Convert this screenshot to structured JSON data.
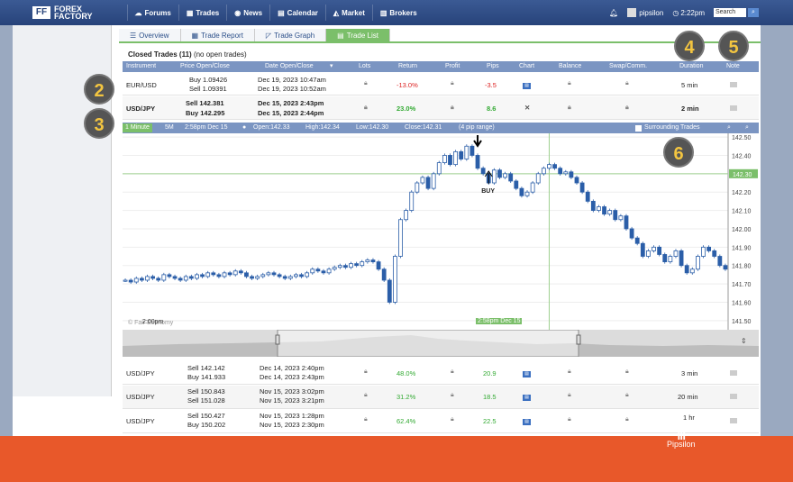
{
  "header": {
    "logo_line1": "FOREX",
    "logo_line2": "FACTORY",
    "nav": [
      {
        "label": "Forums",
        "icon": "forums-icon"
      },
      {
        "label": "Trades",
        "icon": "trades-icon"
      },
      {
        "label": "News",
        "icon": "news-icon"
      },
      {
        "label": "Calendar",
        "icon": "calendar-icon"
      },
      {
        "label": "Market",
        "icon": "market-icon"
      },
      {
        "label": "Brokers",
        "icon": "brokers-icon"
      }
    ],
    "username": "pipsilon",
    "time": "2:22pm",
    "search_placeholder": "Search"
  },
  "tabs": [
    {
      "label": "Overview",
      "active": false
    },
    {
      "label": "Trade Report",
      "active": false
    },
    {
      "label": "Trade Graph",
      "active": false
    },
    {
      "label": "Trade List",
      "active": true
    }
  ],
  "closed_trades": {
    "title": "Closed Trades (11)",
    "subtitle": "(no open trades)"
  },
  "columns": [
    "Instrument",
    "Price Open/Close",
    "Date Open/Close",
    "Lots",
    "Return",
    "Profit",
    "Pips",
    "Chart",
    "Balance",
    "Swap/Comm.",
    "Duration",
    "Note"
  ],
  "rows_top": [
    {
      "instrument": "EUR/USD",
      "price1": "Buy 1.09426",
      "price2": "Sell 1.09391",
      "date1": "Dec 19, 2023 10:47am",
      "date2": "Dec 19, 2023 10:52am",
      "return": "-13.0%",
      "pips": "-3.5",
      "duration": "5 min",
      "bold": false,
      "return_color": "red"
    },
    {
      "instrument": "USD/JPY",
      "price1": "Sell 142.381",
      "price2": "Buy 142.295",
      "date1": "Dec 15, 2023 2:43pm",
      "date2": "Dec 15, 2023 2:44pm",
      "return": "23.0%",
      "pips": "8.6",
      "duration": "2 min",
      "bold": true,
      "return_color": "green"
    }
  ],
  "rows_bottom": [
    {
      "instrument": "USD/JPY",
      "price1": "Sell 142.142",
      "price2": "Buy 141.933",
      "date1": "Dec 14, 2023 2:40pm",
      "date2": "Dec 14, 2023 2:43pm",
      "return": "48.0%",
      "pips": "20.9",
      "duration": "3 min"
    },
    {
      "instrument": "USD/JPY",
      "price1": "Sell 150.843",
      "price2": "Sell 151.028",
      "date1": "Nov 15, 2023 3:02pm",
      "date2": "Nov 15, 2023 3:21pm",
      "return": "31.2%",
      "pips": "18.5",
      "duration": "20 min"
    },
    {
      "instrument": "USD/JPY",
      "price1": "Sell 150.427",
      "price2": "Buy 150.202",
      "date1": "Nov 15, 2023 1:28pm",
      "date2": "Nov 15, 2023 2:30pm",
      "return": "62.4%",
      "pips": "22.5",
      "duration": "1 hr"
    }
  ],
  "chart_toolbar": {
    "tf_1m": "1 Minute",
    "tf_5m": "5M",
    "info_time": "2:58pm Dec 15",
    "info_open": "Open:142.33",
    "info_high": "High:142.34",
    "info_low": "Low:142.30",
    "info_close": "Close:142.31",
    "info_range": "(4 pip range)",
    "surrounding": "Surrounding Trades"
  },
  "chart_labels": {
    "copyright": "© Fair Economy",
    "start_time": "2:00pm",
    "cursor_time": "2:58pm Dec 15",
    "buy_label": "BUY",
    "current_price": "142.30"
  },
  "badges": [
    "2",
    "3",
    "4",
    "5",
    "6"
  ],
  "watermark": {
    "mark": "|||",
    "label": "Pipsilon"
  },
  "chart_data": {
    "type": "line",
    "title": "",
    "xlabel": "",
    "ylabel": "",
    "ylim": [
      141.45,
      142.52
    ],
    "yticks": [
      142.5,
      142.4,
      142.3,
      142.2,
      142.1,
      142.0,
      141.9,
      141.8,
      141.7,
      141.6,
      141.5
    ],
    "series": [
      {
        "name": "",
        "values": [
          141.72,
          141.71,
          141.73,
          141.72,
          141.74,
          141.73,
          141.72,
          141.75,
          141.74,
          141.73,
          141.72,
          141.74,
          141.73,
          141.75,
          141.74,
          141.76,
          141.75,
          141.74,
          141.76,
          141.75,
          141.77,
          141.76,
          141.74,
          141.73,
          141.74,
          141.75,
          141.76,
          141.75,
          141.74,
          141.73,
          141.74,
          141.75,
          141.74,
          141.76,
          141.78,
          141.77,
          141.76,
          141.78,
          141.79,
          141.8,
          141.79,
          141.81,
          141.8,
          141.82,
          141.83,
          141.82,
          141.78,
          141.72,
          141.6,
          141.85,
          142.05,
          142.1,
          142.2,
          142.25,
          142.28,
          142.22,
          142.3,
          142.36,
          142.4,
          142.35,
          142.42,
          142.38,
          142.45,
          142.4,
          142.33,
          142.3,
          142.25,
          142.32,
          142.28,
          142.3,
          142.26,
          142.22,
          142.18,
          142.2,
          142.25,
          142.3,
          142.33,
          142.35,
          142.33,
          142.3,
          142.31,
          142.28,
          142.25,
          142.2,
          142.15,
          142.1,
          142.12,
          142.08,
          142.1,
          142.05,
          142.07,
          142.0,
          141.95,
          141.92,
          141.85,
          141.88,
          141.9,
          141.86,
          141.82,
          141.85,
          141.88,
          141.8,
          141.76,
          141.78,
          141.85,
          141.9,
          141.88,
          141.85,
          141.8,
          141.78
        ]
      }
    ]
  }
}
